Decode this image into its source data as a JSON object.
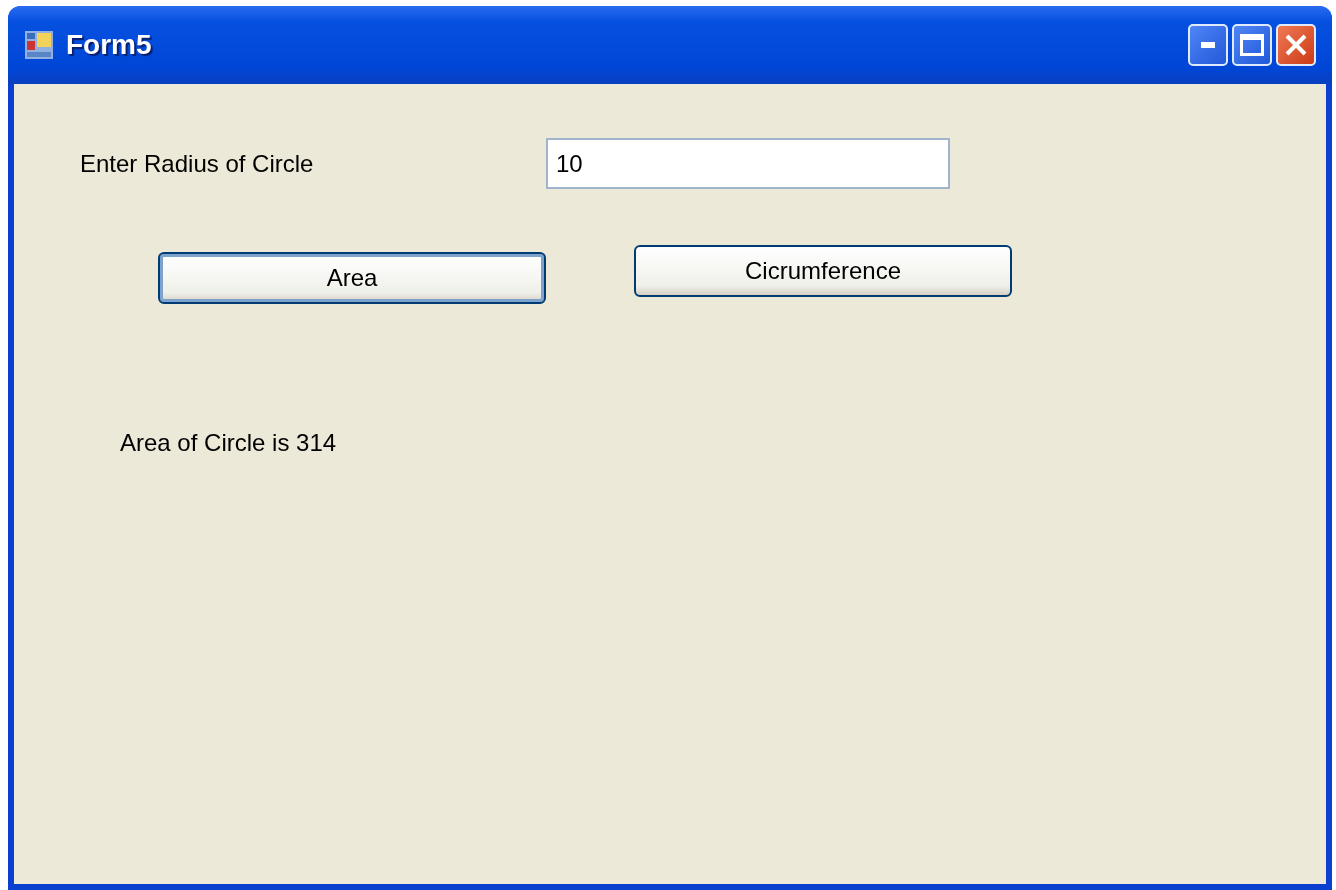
{
  "window": {
    "title": "Form5"
  },
  "radius_label": "Enter Radius of Circle",
  "radius_field": {
    "value": "10"
  },
  "buttons": [
    {
      "label": "Area",
      "focused": true
    },
    {
      "label": "Cicrumference",
      "focused": false
    }
  ],
  "result_label": "Area of Circle is 314"
}
